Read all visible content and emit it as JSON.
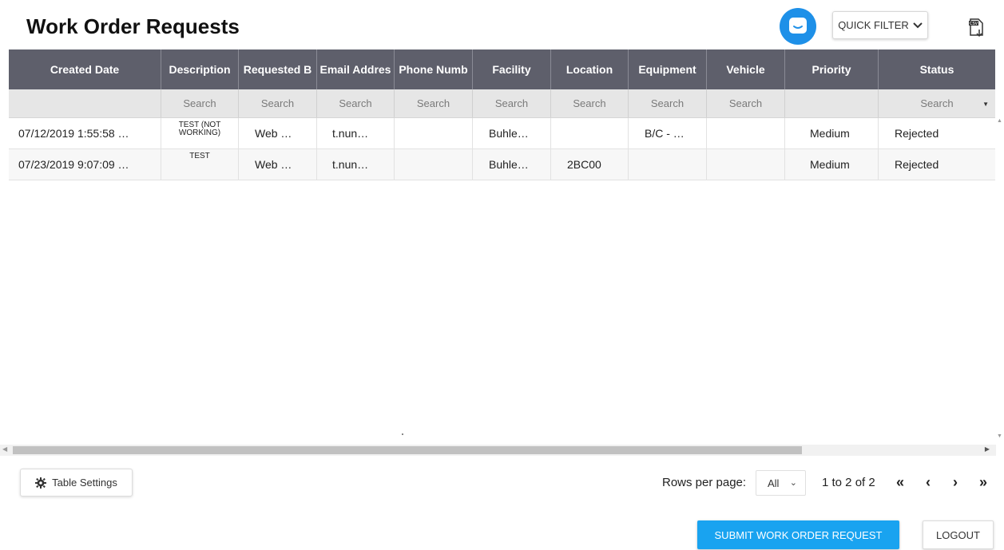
{
  "header": {
    "title": "Work Order Requests",
    "quick_filter_label": "QUICK FILTER",
    "icons": {
      "chat": "chat-bubble-icon",
      "export": "csv-export-icon",
      "chevron": "chevron-down-icon"
    }
  },
  "table": {
    "columns": [
      "Created Date",
      "Description",
      "Requested By",
      "Email Address",
      "Phone Number",
      "Facility",
      "Location",
      "Equipment",
      "Vehicle",
      "Priority",
      "Status"
    ],
    "column_display": [
      "Created Date",
      "Description",
      "Requested B",
      "Email Addres",
      "Phone Numb",
      "Facility",
      "Location",
      "Equipment",
      "Vehicle",
      "Priority",
      "Status"
    ],
    "filters": [
      "",
      "Search",
      "Search",
      "Search",
      "Search",
      "Search",
      "Search",
      "Search",
      "Search",
      "",
      "Search"
    ],
    "rows": [
      [
        "07/12/2019 1:55:58 …",
        "TEST (NOT WORKING)",
        "Web …",
        "t.nun…",
        "",
        "Buhle…",
        "",
        "B/C - …",
        "",
        "Medium",
        "Rejected"
      ],
      [
        "07/23/2019 9:07:09 …",
        "TEST",
        "Web …",
        "t.nun…",
        "",
        "Buhle…",
        "2BC00",
        "",
        "",
        "Medium",
        "Rejected"
      ]
    ]
  },
  "footer": {
    "table_settings_label": "Table Settings",
    "rows_per_page_label": "Rows per page:",
    "rows_per_page_value": "All",
    "page_info": "1 to 2 of 2",
    "pager": {
      "first": "«",
      "prev": "‹",
      "next": "›",
      "last": "»"
    },
    "submit_label": "SUBMIT WORK ORDER REQUEST",
    "logout_label": "LOGOUT"
  },
  "colors": {
    "header_bg": "#5e5f6b",
    "filter_bg": "#e6e6e6",
    "primary": "#19a3f0",
    "chat_blue": "#1e90e8"
  }
}
